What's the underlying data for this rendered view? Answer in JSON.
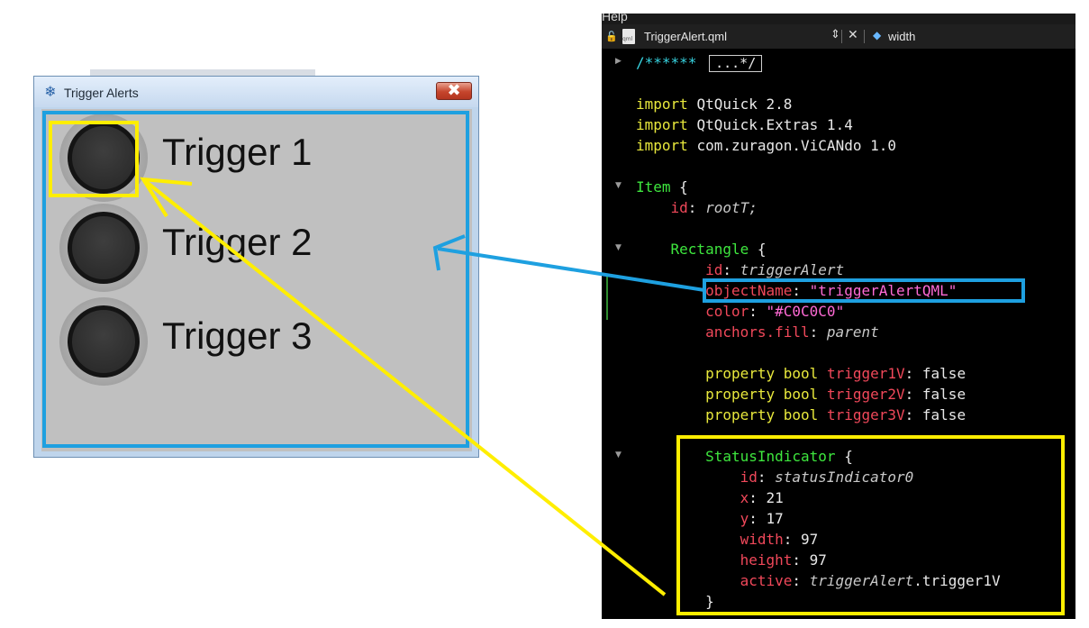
{
  "window": {
    "title": "Trigger Alerts",
    "close_symbol": "✖",
    "icon": "snowflake-icon",
    "client_color": "#C0C0C0",
    "triggers": [
      {
        "label": "Trigger 1"
      },
      {
        "label": "Trigger 2"
      },
      {
        "label": "Trigger 3"
      }
    ]
  },
  "editor": {
    "menu_label": "Help",
    "tab": {
      "filename": "TriggerAlert.qml",
      "file_icon_text": "qml",
      "arrows": "⇕",
      "close": "✕",
      "symbol": "width"
    },
    "code": {
      "comment_start": "/******",
      "fold_marker": "...*/",
      "imports": [
        {
          "kw": "import",
          "module": "QtQuick 2.8"
        },
        {
          "kw": "import",
          "module": "QtQuick.Extras 1.4"
        },
        {
          "kw": "import",
          "module": "com.zuragon.ViCANdo 1.0"
        }
      ],
      "item_type": "Item",
      "item_id": "rootT;",
      "rect_type": "Rectangle",
      "rect_id": "triggerAlert",
      "object_name_prop": "objectName",
      "object_name_val": "\"triggerAlertQML\"",
      "color_prop": "color",
      "color_val": "\"#C0C0C0\"",
      "anchors_prop": "anchors.fill",
      "anchors_val": "parent",
      "properties": [
        {
          "kw": "property bool",
          "name": "trigger1V",
          "val": "false"
        },
        {
          "kw": "property bool",
          "name": "trigger2V",
          "val": "false"
        },
        {
          "kw": "property bool",
          "name": "trigger3V",
          "val": "false"
        }
      ],
      "status_type": "StatusIndicator",
      "status_id": "statusIndicator0",
      "x_val": "21",
      "y_val": "17",
      "width_val": "97",
      "height_val": "97",
      "active_obj": "triggerAlert",
      "active_member": ".trigger1V",
      "close_brace": "}",
      "open_brace": "{",
      "id_prop": "id"
    }
  },
  "annotation_colors": {
    "blue": "#1EA0E0",
    "yellow": "#FFEE00"
  }
}
